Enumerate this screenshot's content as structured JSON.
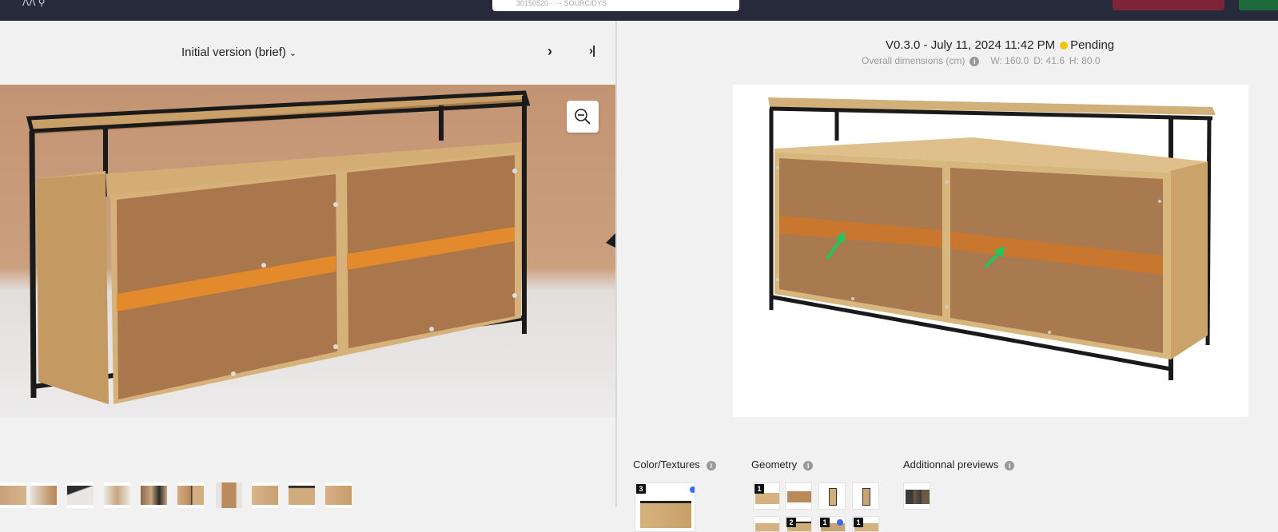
{
  "topbar": {
    "center_text": "30150520 · ··· SOURCIDYS"
  },
  "left": {
    "version_label": "Initial version (brief)",
    "thumbnails_count": 10
  },
  "right": {
    "version": "V0.3.0 - July 11, 2024 11:42 PM",
    "status": "Pending",
    "status_color": "#f5c400",
    "dims_label": "Overall dimensions (cm)",
    "width": "W: 160.0",
    "depth": "D: 41.6",
    "height": "H: 80.0",
    "sections": {
      "color_textures": "Color/Textures",
      "geometry": "Geometry",
      "additional_previews": "Additionnal previews"
    },
    "color_tile_badge": "3",
    "geometry_badges": [
      "1",
      "2",
      "1",
      "1"
    ]
  },
  "colors": {
    "topbar": "#262a3a",
    "accent_blue": "#3b6cf5",
    "arrow_green": "#22c55e"
  }
}
